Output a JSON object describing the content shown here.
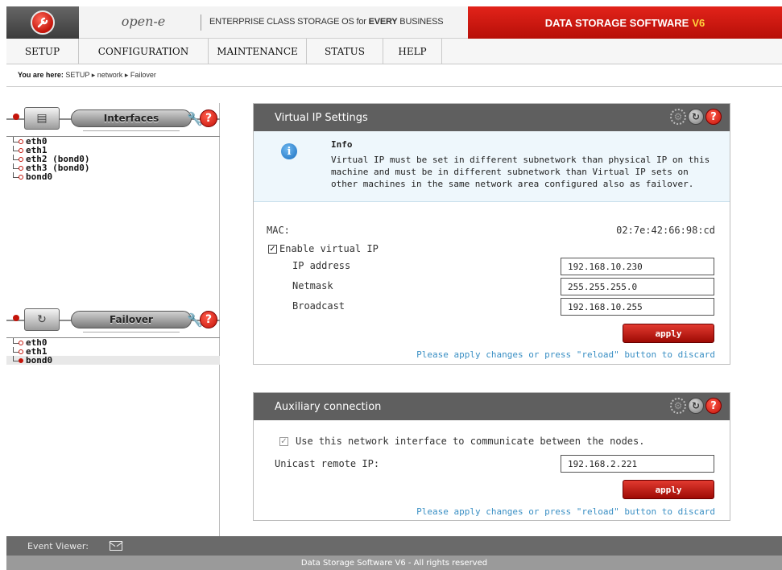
{
  "header": {
    "brand": "open-e",
    "tagline_prefix": "ENTERPRISE CLASS STORAGE OS for ",
    "tagline_strong": "EVERY",
    "tagline_suffix": " BUSINESS",
    "product": "DATA STORAGE SOFTWARE",
    "product_version": "V6",
    "logo_icon": "wrench-icon"
  },
  "menu": {
    "items": [
      {
        "label": "SETUP"
      },
      {
        "label": "CONFIGURATION"
      },
      {
        "label": "MAINTENANCE"
      },
      {
        "label": "STATUS"
      },
      {
        "label": "HELP"
      }
    ]
  },
  "breadcrumb": {
    "prefix": "You are here:",
    "items": [
      "SETUP",
      "network",
      "Failover"
    ]
  },
  "left": {
    "interfaces": {
      "title": "Interfaces",
      "items": [
        "eth0",
        "eth1",
        "eth2 (bond0)",
        "eth3 (bond0)",
        "bond0"
      ]
    },
    "failover": {
      "title": "Failover",
      "items": [
        "eth0",
        "eth1",
        "bond0"
      ],
      "selected": "bond0"
    }
  },
  "virtual_ip": {
    "title": "Virtual IP Settings",
    "info_title": "Info",
    "info_text": "Virtual IP must be set in different subnetwork than physical IP on this machine and must be in different subnetwork than Virtual IP sets on other machines in the same network area configured also as failover.",
    "mac_label": "MAC:",
    "mac_value": "02:7e:42:66:98:cd",
    "enable_label": "Enable virtual IP",
    "enable_checked": true,
    "ip_label": "IP address",
    "ip_value": "192.168.10.230",
    "netmask_label": "Netmask",
    "netmask_value": "255.255.255.0",
    "broadcast_label": "Broadcast",
    "broadcast_value": "192.168.10.255",
    "apply_label": "apply",
    "hint": "Please apply changes or press \"reload\" button to discard"
  },
  "aux": {
    "title": "Auxiliary connection",
    "use_label": "Use this network interface to communicate between the nodes.",
    "use_checked": true,
    "unicast_label": "Unicast remote IP:",
    "unicast_value": "192.168.2.221",
    "apply_label": "apply",
    "hint": "Please apply changes or press \"reload\" button to discard"
  },
  "footer": {
    "event_viewer": "Event Viewer:",
    "copyright": "Data Storage Software V6 - All rights reserved"
  },
  "colors": {
    "accent_red": "#c4140a",
    "box_title_bg": "#5f5f5f",
    "hint_blue": "#3a8fc4"
  }
}
